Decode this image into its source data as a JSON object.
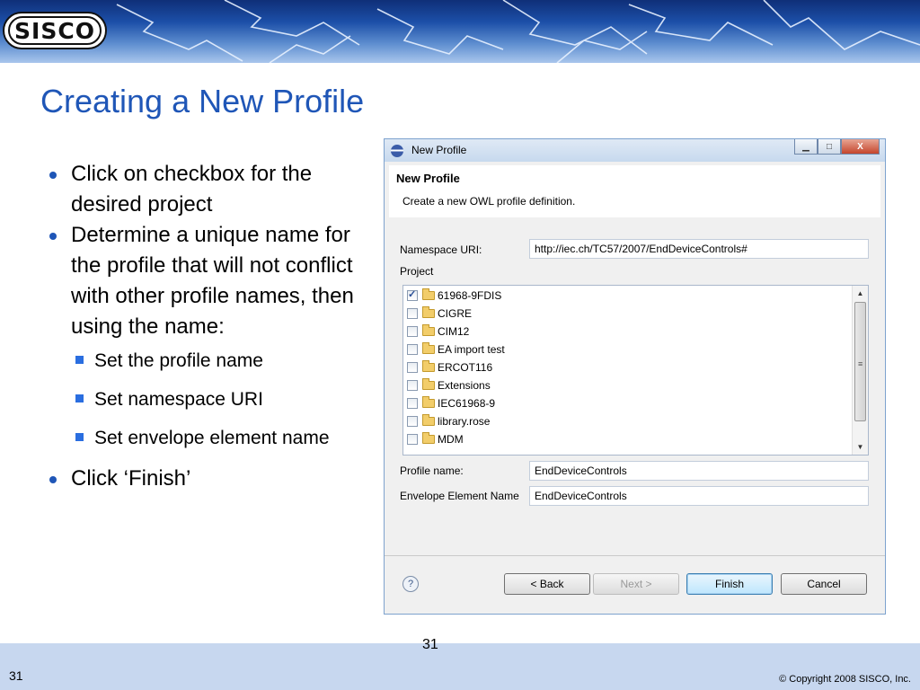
{
  "header": {
    "logo_text": "SISCO"
  },
  "slide_title": "Creating a New Profile",
  "bullets": {
    "b1": "Click on checkbox for the desired project",
    "b2": "Determine a unique name for the profile that will not conflict with other profile names, then using the name:",
    "subs": [
      "Set the profile name",
      "Set namespace URI",
      "Set envelope element name"
    ],
    "b3": "Click ‘Finish’"
  },
  "dialog": {
    "title": "New Profile",
    "header_title": "New Profile",
    "header_desc": "Create a new OWL profile definition.",
    "namespace_label": "Namespace URI:",
    "namespace_value": "http://iec.ch/TC57/2007/EndDeviceControls#",
    "project_label": "Project",
    "projects": [
      {
        "name": "61968-9FDIS",
        "checked": true
      },
      {
        "name": "CIGRE",
        "checked": false
      },
      {
        "name": "CIM12",
        "checked": false
      },
      {
        "name": "EA import test",
        "checked": false
      },
      {
        "name": "ERCOT116",
        "checked": false
      },
      {
        "name": "Extensions",
        "checked": false
      },
      {
        "name": "IEC61968-9",
        "checked": false
      },
      {
        "name": "library.rose",
        "checked": false
      },
      {
        "name": "MDM",
        "checked": false
      }
    ],
    "profile_name_label": "Profile name:",
    "profile_name_value": "EndDeviceControls",
    "envelope_label": "Envelope Element Name",
    "envelope_value": "EndDeviceControls",
    "help_symbol": "?",
    "back_label": "< Back",
    "next_label": "Next >",
    "finish_label": "Finish",
    "cancel_label": "Cancel",
    "minimize_glyph": "▁",
    "maximize_glyph": "□",
    "close_glyph": "X"
  },
  "footer": {
    "page_number_center": "31",
    "page_number_left": "31",
    "copyright": "© Copyright 2008 SISCO, Inc."
  }
}
